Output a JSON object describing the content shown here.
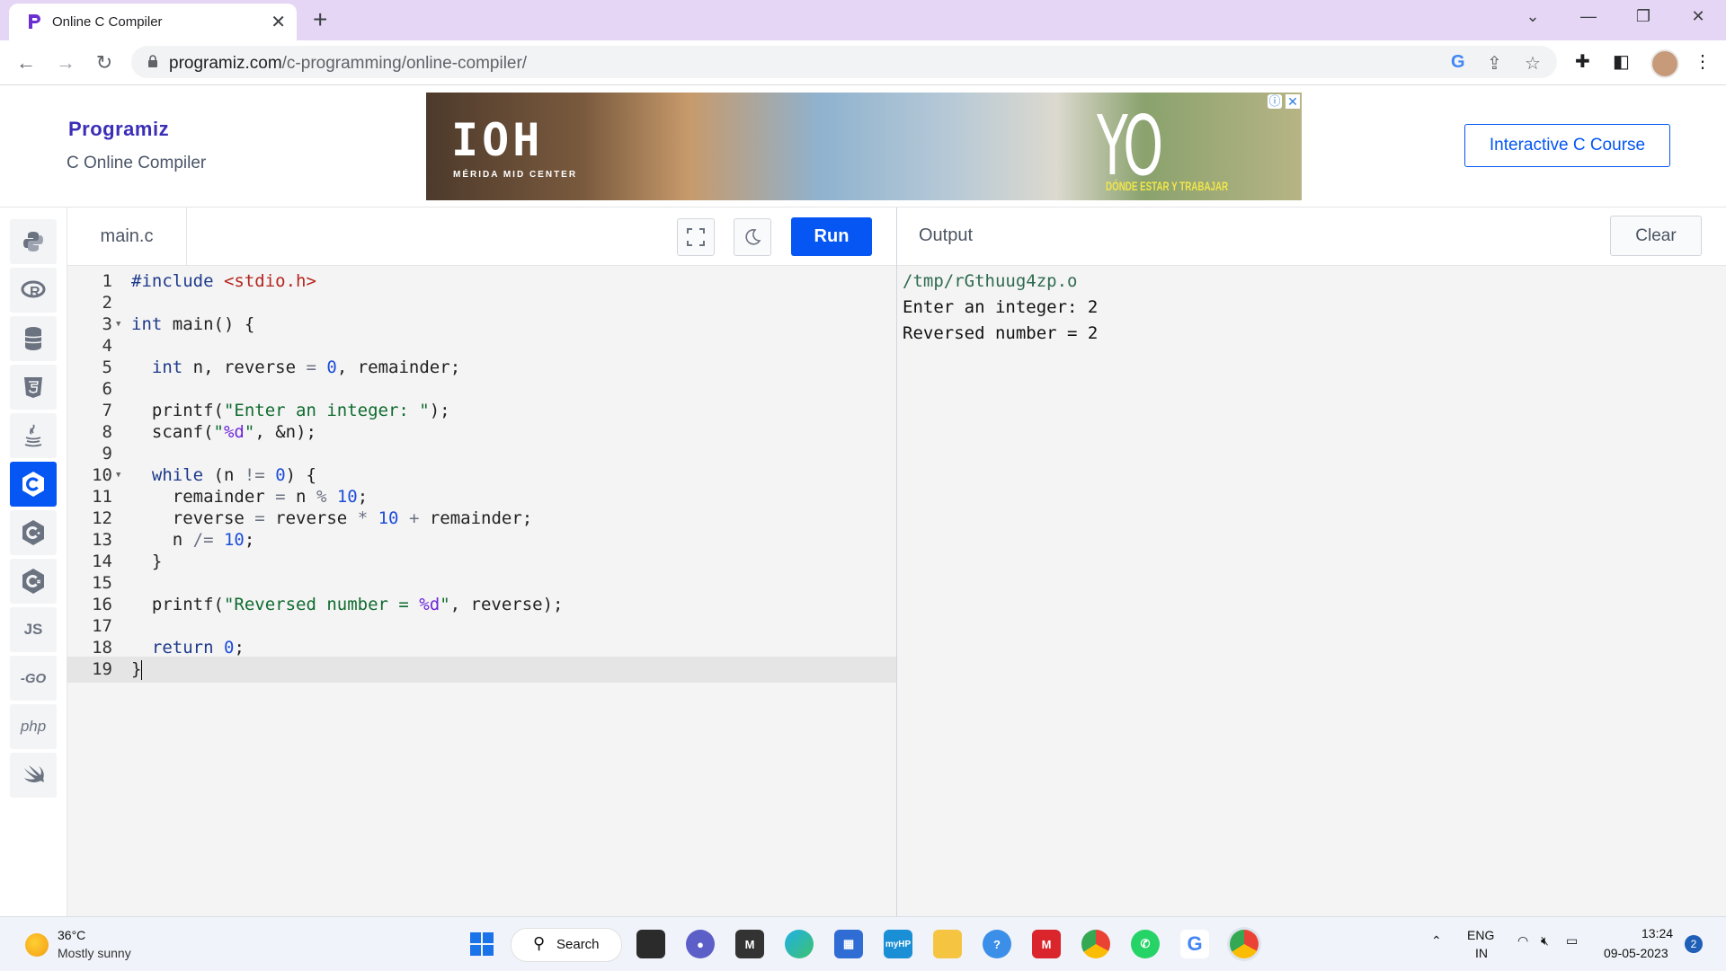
{
  "browser": {
    "tab_title": "Online C Compiler",
    "url_host": "programiz.com",
    "url_path": "/c-programming/online-compiler/"
  },
  "site": {
    "logo": "Programiz",
    "subtitle": "C Online Compiler",
    "course_button": "Interactive C Course"
  },
  "ad": {
    "brand": "IOH",
    "brand_sub": "MÉRIDA MID CENTER",
    "slogan": "YO ELIJO",
    "slogan_sub": "DÓNDE ESTAR Y TRABAJAR"
  },
  "sidebar": {
    "active": "c",
    "items": [
      "python",
      "r",
      "sql",
      "html",
      "java",
      "c",
      "cpp",
      "csharp",
      "js",
      "go",
      "php",
      "swift"
    ],
    "labels": {
      "js": "JS",
      "go": "-GO",
      "php": "php"
    }
  },
  "editor": {
    "file_name": "main.c",
    "run_label": "Run",
    "current_line": 19,
    "lines": [
      "#include <stdio.h>",
      "",
      "int main() {",
      "",
      "  int n, reverse = 0, remainder;",
      "",
      "  printf(\"Enter an integer: \");",
      "  scanf(\"%d\", &n);",
      "",
      "  while (n != 0) {",
      "    remainder = n % 10;",
      "    reverse = reverse * 10 + remainder;",
      "    n /= 10;",
      "  }",
      "",
      "  printf(\"Reversed number = %d\", reverse);",
      "",
      "  return 0;",
      "}"
    ],
    "fold_lines": [
      3,
      10
    ]
  },
  "output": {
    "title": "Output",
    "clear_label": "Clear",
    "lines": [
      "/tmp/rGthuug4zp.o",
      "Enter an integer: 2",
      "Reversed number = 2"
    ]
  },
  "taskbar": {
    "temperature": "36°C",
    "condition": "Mostly sunny",
    "search_label": "Search",
    "lang_top": "ENG",
    "lang_bottom": "IN",
    "time": "13:24",
    "date": "09-05-2023",
    "notifications": "2"
  }
}
